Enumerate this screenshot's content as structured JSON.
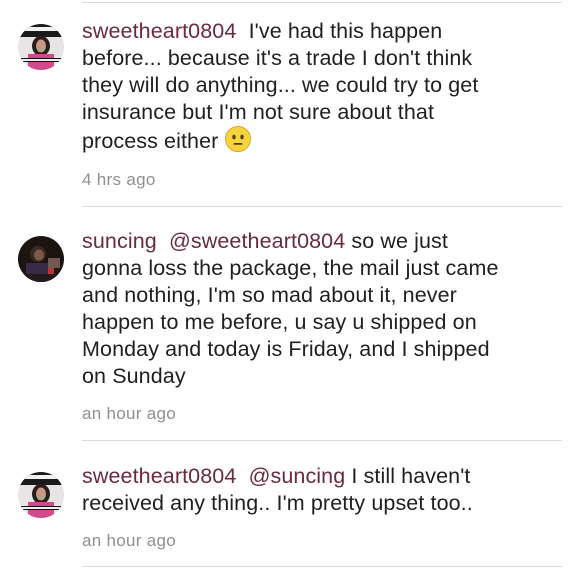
{
  "comments": [
    {
      "username": "sweetheart0804",
      "mention": "",
      "lines": [
        "I've had this happen",
        "before... because it's a trade I don't think",
        "they will do anything... we could try to get",
        "insurance but I'm not sure about that",
        "process either"
      ],
      "emoji": "neutral-face-emoji",
      "time": "4 hrs ago"
    },
    {
      "username": "suncing",
      "mention": "@sweetheart0804",
      "lines": [
        "so we just",
        "gonna loss the package,  the mail just came",
        "and nothing, I'm so mad about it, never",
        "happen to me before, u say u shipped on",
        "Monday and today is Friday,  and I shipped",
        "on Sunday"
      ],
      "emoji": "",
      "time": "an hour ago"
    },
    {
      "username": "sweetheart0804",
      "mention": "@suncing",
      "lines": [
        "I still haven't",
        "received any thing.. I'm pretty upset too.."
      ],
      "emoji": "",
      "time": "an hour ago"
    }
  ],
  "colors": {
    "username": "#6b2a3c",
    "time": "#8f8f8f",
    "divider": "#dcdcdc",
    "text": "#1f1f1f"
  }
}
